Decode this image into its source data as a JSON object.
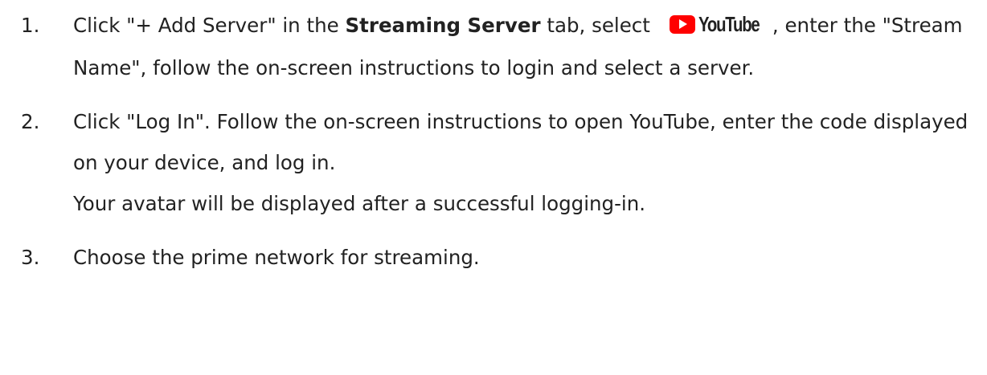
{
  "steps": [
    {
      "number": "1.",
      "part1": "Click \"+ Add Server\" in the ",
      "bold": "Streaming Server",
      "part2": " tab, select",
      "logo_text": "YouTube",
      "part3": ", enter the \"Stream Name\", follow the on-screen instructions to login and select a server."
    },
    {
      "number": "2.",
      "line1": "Click \"Log In\". Follow the on-screen instructions to open YouTube, enter the code displayed on your device, and log in.",
      "line2": "Your avatar will be displayed after a successful logging-in."
    },
    {
      "number": "3.",
      "text": "Choose the prime network for streaming."
    }
  ],
  "colors": {
    "text": "#222222",
    "youtube_red": "#ff0000"
  },
  "icons": {
    "youtube_logo": "youtube-logo-icon"
  }
}
